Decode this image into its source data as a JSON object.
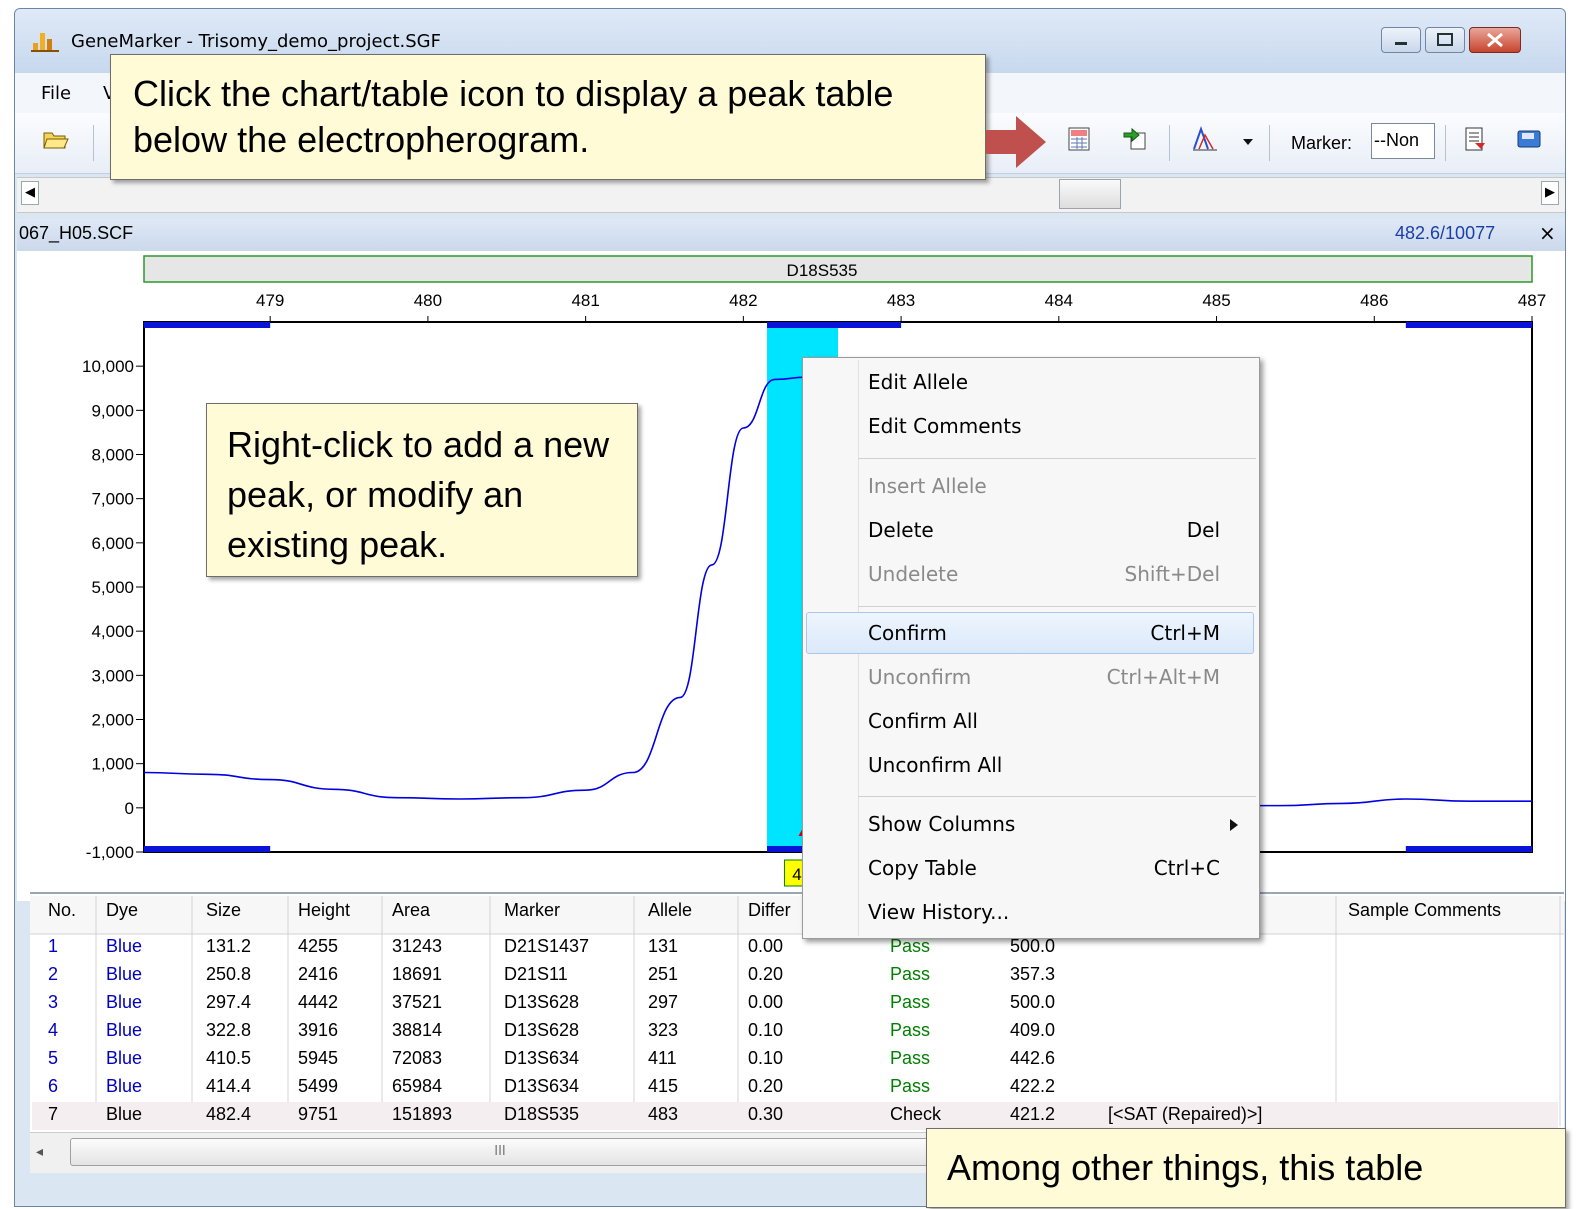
{
  "window": {
    "title": "GeneMarker - Trisomy_demo_project.SGF",
    "menu": [
      "File",
      "V"
    ]
  },
  "toolbar": {
    "marker_label": "Marker:",
    "marker_value": "--Non"
  },
  "sample": {
    "filename": "067_H05.SCF",
    "position": "482.6/10077",
    "close": "×"
  },
  "chart_data": {
    "type": "line",
    "marker_name": "D18S535",
    "x_ticks": [
      "479",
      "480",
      "481",
      "482",
      "483",
      "484",
      "485",
      "486",
      "487"
    ],
    "y_ticks": [
      "10,000",
      "9,000",
      "8,000",
      "7,000",
      "6,000",
      "5,000",
      "4,000",
      "3,000",
      "2,000",
      "1,000",
      "0",
      "-1,000"
    ],
    "ylim": [
      -1000,
      11000
    ],
    "xlim": [
      478.2,
      487
    ],
    "series": [
      {
        "color": "#0000e0",
        "x": [
          478.2,
          478.6,
          479.0,
          479.4,
          479.8,
          480.2,
          480.6,
          481.0,
          481.3,
          481.6,
          481.8,
          482.0,
          482.2,
          482.4,
          482.6,
          482.8,
          483.0,
          483.4,
          483.8,
          484.2,
          484.6,
          485.0,
          485.4,
          485.8,
          486.2,
          486.6,
          487.0
        ],
        "y": [
          800,
          760,
          640,
          420,
          230,
          200,
          230,
          400,
          800,
          2500,
          5500,
          8600,
          9700,
          9751,
          9400,
          6000,
          3000,
          1400,
          200,
          0,
          0,
          50,
          50,
          100,
          200,
          150,
          150
        ]
      }
    ],
    "peak_label": "483",
    "highlight_x": [
      482.15,
      482.6
    ]
  },
  "context_menu": {
    "items": [
      {
        "label": "Edit Allele",
        "shortcut": "",
        "disabled": false
      },
      {
        "label": "Edit Comments",
        "shortcut": "",
        "disabled": false
      },
      {
        "label": "Insert Allele",
        "shortcut": "",
        "disabled": true
      },
      {
        "label": "Delete",
        "shortcut": "Del",
        "disabled": false
      },
      {
        "label": "Undelete",
        "shortcut": "Shift+Del",
        "disabled": true
      },
      {
        "label": "Confirm",
        "shortcut": "Ctrl+M",
        "disabled": false
      },
      {
        "label": "Unconfirm",
        "shortcut": "Ctrl+Alt+M",
        "disabled": true
      },
      {
        "label": "Confirm All",
        "shortcut": "",
        "disabled": false
      },
      {
        "label": "Unconfirm All",
        "shortcut": "",
        "disabled": false
      },
      {
        "label": "Show Columns",
        "shortcut": "",
        "disabled": false
      },
      {
        "label": "Copy Table",
        "shortcut": "Ctrl+C",
        "disabled": false
      },
      {
        "label": "View History...",
        "shortcut": "",
        "disabled": false
      }
    ]
  },
  "table": {
    "headers": [
      "No.",
      "Dye",
      "Size",
      "Height",
      "Area",
      "Marker",
      "Allele",
      "Differ",
      "Sample Comments"
    ],
    "rows": [
      [
        "1",
        "Blue",
        "131.2",
        "4255",
        "31243",
        "D21S1437",
        "131",
        "0.00",
        "Pass",
        "500.0",
        ""
      ],
      [
        "2",
        "Blue",
        "250.8",
        "2416",
        "18691",
        "D21S11",
        "251",
        "0.20",
        "Pass",
        "357.3",
        ""
      ],
      [
        "3",
        "Blue",
        "297.4",
        "4442",
        "37521",
        "D13S628",
        "297",
        "0.00",
        "Pass",
        "500.0",
        ""
      ],
      [
        "4",
        "Blue",
        "322.8",
        "3916",
        "38814",
        "D13S628",
        "323",
        "0.10",
        "Pass",
        "409.0",
        ""
      ],
      [
        "5",
        "Blue",
        "410.5",
        "5945",
        "72083",
        "D13S634",
        "411",
        "0.10",
        "Pass",
        "442.6",
        ""
      ],
      [
        "6",
        "Blue",
        "414.4",
        "5499",
        "65984",
        "D13S634",
        "415",
        "0.20",
        "Pass",
        "422.2",
        ""
      ],
      [
        "7",
        "Blue",
        "482.4",
        "9751",
        "151893",
        "D18S535",
        "483",
        "0.30",
        "Check",
        "421.2",
        "[<SAT (Repaired)>]"
      ]
    ],
    "scroll_label": "III"
  },
  "callouts": {
    "top": "Click the chart/table icon to display a peak table below the electropherogram.",
    "middle": "Right-click to add a new peak, or modify an existing peak.",
    "bottom": "Among other things, this table"
  },
  "colors": {
    "pass": "#008000",
    "blue_row": "#0000c0",
    "highlight": "#00e5ff",
    "arrow": "#c0504d"
  }
}
